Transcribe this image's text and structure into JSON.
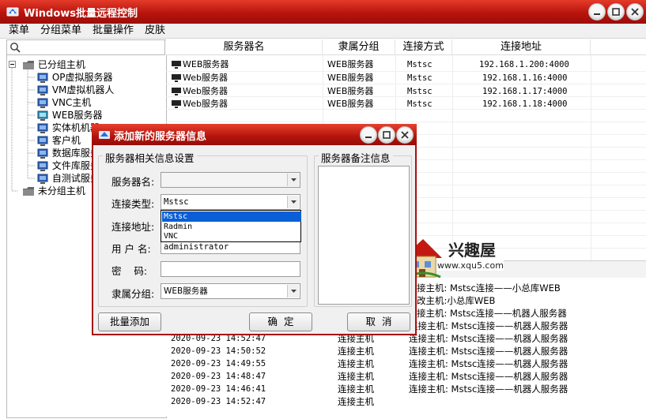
{
  "window": {
    "title": "Windows批量远程控制"
  },
  "menu": [
    "菜单",
    "分组菜单",
    "批量操作",
    "皮肤"
  ],
  "tree": {
    "root_grouped": "已分组主机",
    "groups": [
      "OP虚拟服务器",
      "VM虚拟机器人",
      "VNC主机",
      "WEB服务器",
      "实体机机器",
      "客户机",
      "数据库服务",
      "文件库服务",
      "自测试服务"
    ],
    "root_ungrouped": "未分组主机"
  },
  "table": {
    "headers": [
      "服务器名",
      "隶属分组",
      "连接方式",
      "连接地址"
    ],
    "rows": [
      {
        "name": "WEB服务器",
        "group": "WEB服务器",
        "method": "Mstsc",
        "addr": "192.168.1.200:4000"
      },
      {
        "name": "Web服务器",
        "group": "WEB服务器",
        "method": "Mstsc",
        "addr": "192.168.1.16:4000"
      },
      {
        "name": "Web服务器",
        "group": "WEB服务器",
        "method": "Mstsc",
        "addr": "192.168.1.17:4000"
      },
      {
        "name": "Web服务器",
        "group": "WEB服务器",
        "method": "Mstsc",
        "addr": "192.168.1.18:4000"
      }
    ]
  },
  "log": {
    "header_fragment": "情",
    "right_fragments": [
      "接主机: Mstsc连接——小总库WEB",
      "改主机:小总库WEB",
      "接主机: Mstsc连接——机器人服务器"
    ],
    "rows": [
      {
        "time": "2020-09-23 14:52:47",
        "action": "连接主机",
        "detail": "连接主机: Mstsc连接——机器人服务器"
      },
      {
        "time": "2020-09-23 14:52:47",
        "action": "连接主机",
        "detail": "连接主机: Mstsc连接——机器人服务器"
      },
      {
        "time": "2020-09-23 14:50:52",
        "action": "连接主机",
        "detail": "连接主机: Mstsc连接——机器人服务器"
      },
      {
        "time": "2020-09-23 14:49:55",
        "action": "连接主机",
        "detail": "连接主机: Mstsc连接——机器人服务器"
      },
      {
        "time": "2020-09-23 14:48:47",
        "action": "连接主机",
        "detail": "连接主机: Mstsc连接——机器人服务器"
      },
      {
        "time": "2020-09-23 14:46:41",
        "action": "连接主机",
        "detail": "连接主机: Mstsc连接——机器人服务器"
      }
    ]
  },
  "dialog": {
    "title": "添加新的服务器信息",
    "group_settings": "服务器相关信息设置",
    "group_notes": "服务器备注信息",
    "labels": {
      "name": "服务器名:",
      "type": "连接类型:",
      "addr": "连接地址:",
      "user": "用 户 名:",
      "pass": "密    码:",
      "group": "隶属分组:"
    },
    "values": {
      "name": "",
      "type": "Mstsc",
      "user": "administrator",
      "pass": "",
      "group": "WEB服务器"
    },
    "type_options": [
      "Mstsc",
      "Radmin",
      "VNC"
    ],
    "buttons": {
      "batch": "批量添加",
      "ok": "确  定",
      "cancel": "取  消"
    }
  },
  "watermark": {
    "brand": "兴趣屋",
    "site": "www.xqu5.com"
  },
  "colors": {
    "title_red": "#b8140d",
    "select_blue": "#0a5fd6"
  }
}
